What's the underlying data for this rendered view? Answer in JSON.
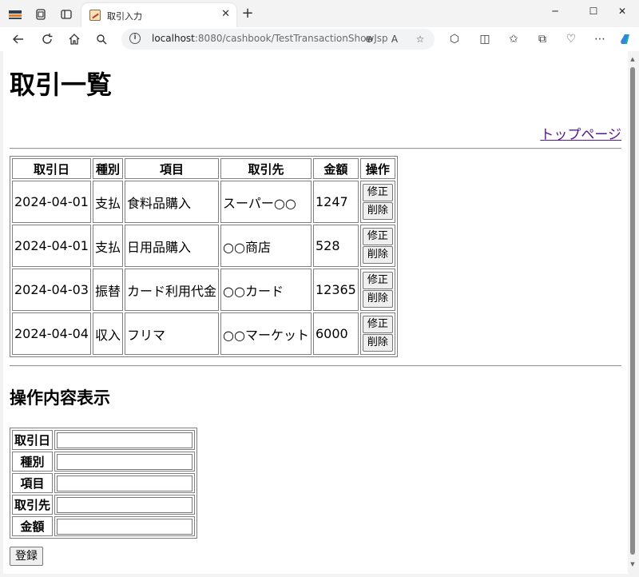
{
  "browser": {
    "tab_title": "取引入力",
    "url_host": "localhost",
    "url_rest": ":8080/cashbook/TestTransactionShowJsp",
    "window_controls": [
      "─",
      "☐",
      "✕"
    ],
    "toolbar_icons": [
      "back-icon",
      "refresh-icon",
      "home-icon",
      "search-icon"
    ]
  },
  "page": {
    "title": "取引一覧",
    "top_link": "トップページ",
    "section_title": "操作内容表示",
    "submit_label": "登録"
  },
  "table": {
    "headers": [
      "取引日",
      "種別",
      "項目",
      "取引先",
      "金額",
      "操作"
    ],
    "rows": [
      {
        "date": "2024-04-01",
        "type": "支払",
        "item": "食料品購入",
        "partner": "スーパー○○",
        "amount": "1247",
        "edit": "修正",
        "delete": "削除"
      },
      {
        "date": "2024-04-01",
        "type": "支払",
        "item": "日用品購入",
        "partner": "○○商店",
        "amount": "528",
        "edit": "修正",
        "delete": "削除"
      },
      {
        "date": "2024-04-03",
        "type": "振替",
        "item": "カード利用代金",
        "partner": "○○カード",
        "amount": "12365",
        "edit": "修正",
        "delete": "削除"
      },
      {
        "date": "2024-04-04",
        "type": "収入",
        "item": "フリマ",
        "partner": "○○マーケット",
        "amount": "6000",
        "edit": "修正",
        "delete": "削除"
      }
    ]
  },
  "form": {
    "labels": [
      "取引日",
      "種別",
      "項目",
      "取引先",
      "金額"
    ],
    "values": [
      "",
      "",
      "",
      "",
      ""
    ]
  }
}
